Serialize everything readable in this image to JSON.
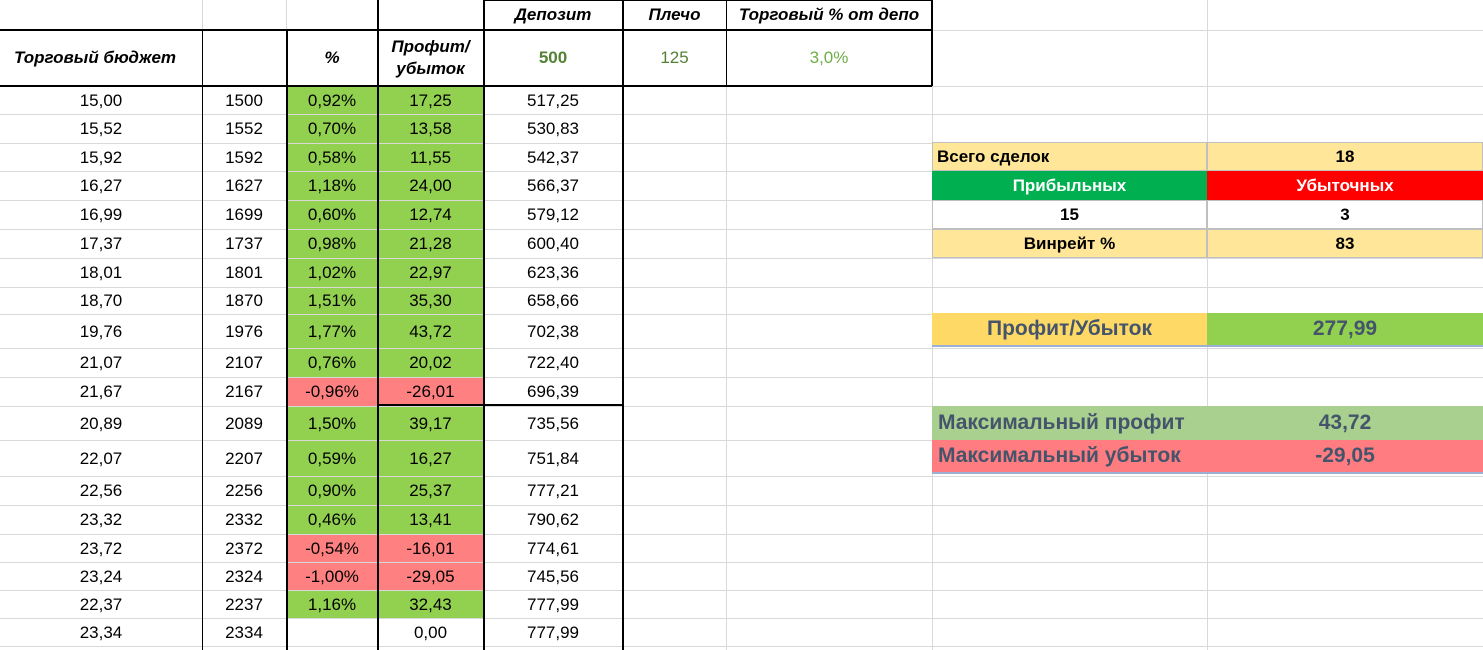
{
  "header": {
    "budget": "Торговый бюджет",
    "percent": "%",
    "profit_line1": "Профит/",
    "profit_line2": "убыток",
    "deposit": "Депозит",
    "leverage": "Плечо",
    "trade_pct": "Торговый % от депо",
    "deposit_value": "500",
    "leverage_value": "125",
    "trade_pct_value": "3,0%"
  },
  "rows": [
    {
      "budget": "15,00",
      "size": "1500",
      "pct": "0,92%",
      "pl": "17,25",
      "dep": "517,25",
      "state": "win"
    },
    {
      "budget": "15,52",
      "size": "1552",
      "pct": "0,70%",
      "pl": "13,58",
      "dep": "530,83",
      "state": "win"
    },
    {
      "budget": "15,92",
      "size": "1592",
      "pct": "0,58%",
      "pl": "11,55",
      "dep": "542,37",
      "state": "win"
    },
    {
      "budget": "16,27",
      "size": "1627",
      "pct": "1,18%",
      "pl": "24,00",
      "dep": "566,37",
      "state": "win"
    },
    {
      "budget": "16,99",
      "size": "1699",
      "pct": "0,60%",
      "pl": "12,74",
      "dep": "579,12",
      "state": "win"
    },
    {
      "budget": "17,37",
      "size": "1737",
      "pct": "0,98%",
      "pl": "21,28",
      "dep": "600,40",
      "state": "win"
    },
    {
      "budget": "18,01",
      "size": "1801",
      "pct": "1,02%",
      "pl": "22,97",
      "dep": "623,36",
      "state": "win"
    },
    {
      "budget": "18,70",
      "size": "1870",
      "pct": "1,51%",
      "pl": "35,30",
      "dep": "658,66",
      "state": "win"
    },
    {
      "budget": "19,76",
      "size": "1976",
      "pct": "1,77%",
      "pl": "43,72",
      "dep": "702,38",
      "state": "win"
    },
    {
      "budget": "21,07",
      "size": "2107",
      "pct": "0,76%",
      "pl": "20,02",
      "dep": "722,40",
      "state": "win"
    },
    {
      "budget": "21,67",
      "size": "2167",
      "pct": "-0,96%",
      "pl": "-26,01",
      "dep": "696,39",
      "state": "loss"
    },
    {
      "budget": "20,89",
      "size": "2089",
      "pct": "1,50%",
      "pl": "39,17",
      "dep": "735,56",
      "state": "win"
    },
    {
      "budget": "22,07",
      "size": "2207",
      "pct": "0,59%",
      "pl": "16,27",
      "dep": "751,84",
      "state": "win"
    },
    {
      "budget": "22,56",
      "size": "2256",
      "pct": "0,90%",
      "pl": "25,37",
      "dep": "777,21",
      "state": "win"
    },
    {
      "budget": "23,32",
      "size": "2332",
      "pct": "0,46%",
      "pl": "13,41",
      "dep": "790,62",
      "state": "win"
    },
    {
      "budget": "23,72",
      "size": "2372",
      "pct": "-0,54%",
      "pl": "-16,01",
      "dep": "774,61",
      "state": "loss"
    },
    {
      "budget": "23,24",
      "size": "2324",
      "pct": "-1,00%",
      "pl": "-29,05",
      "dep": "745,56",
      "state": "loss"
    },
    {
      "budget": "22,37",
      "size": "2237",
      "pct": "1,16%",
      "pl": "32,43",
      "dep": "777,99",
      "state": "win"
    },
    {
      "budget": "23,34",
      "size": "2334",
      "pct": "",
      "pl": "0,00",
      "dep": "777,99",
      "state": "none"
    }
  ],
  "summary": {
    "total_label": "Всего сделок",
    "total_value": "18",
    "wins_label": "Прибыльных",
    "losses_label": "Убыточных",
    "wins_value": "15",
    "losses_value": "3",
    "winrate_label": "Винрейт %",
    "winrate_value": "83",
    "pl_label": "Профит/Убыток",
    "pl_value": "277,99",
    "max_profit_label": "Максимальный профит",
    "max_profit_value": "43,72",
    "max_loss_label": "Максимальный убыток",
    "max_loss_value": "-29,05"
  },
  "colors": {
    "win": "#92d050",
    "loss": "#ff8080",
    "summary_bg": "#ffe699",
    "wins_header": "#00b050",
    "losses_header": "#ff0000",
    "pl_label_bg": "#ffd966",
    "max_profit_bg": "#a9d08e",
    "dark_green_text": "#538135",
    "light_green_text": "#70ad47"
  }
}
